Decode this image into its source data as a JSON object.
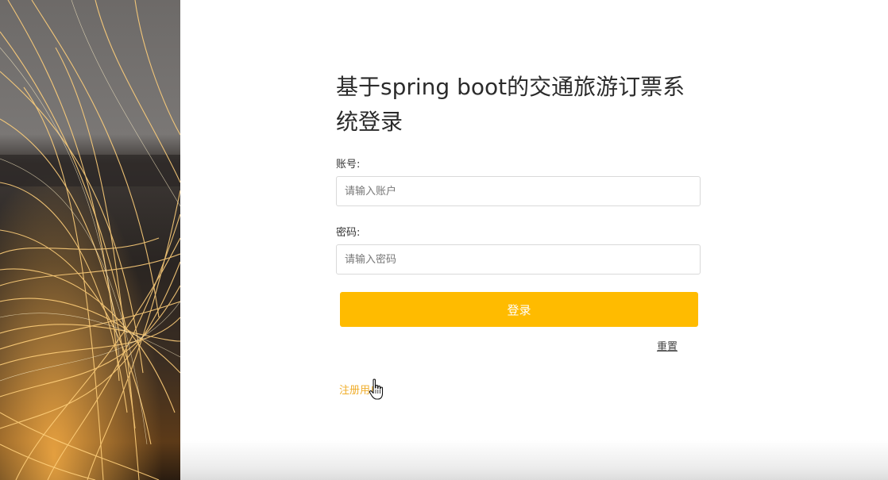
{
  "title": "基于spring boot的交通旅游订票系统登录",
  "form": {
    "account_label": "账号:",
    "account_placeholder": "请输入账户",
    "account_value": "",
    "password_label": "密码:",
    "password_placeholder": "请输入密码",
    "password_value": "",
    "login_label": "登录",
    "reset_label": "重置",
    "register_label": "注册用户"
  },
  "colors": {
    "accent": "#ffbb00",
    "register_link": "#f0ad2a"
  },
  "icons": {
    "cursor": "hand-pointer-icon"
  }
}
